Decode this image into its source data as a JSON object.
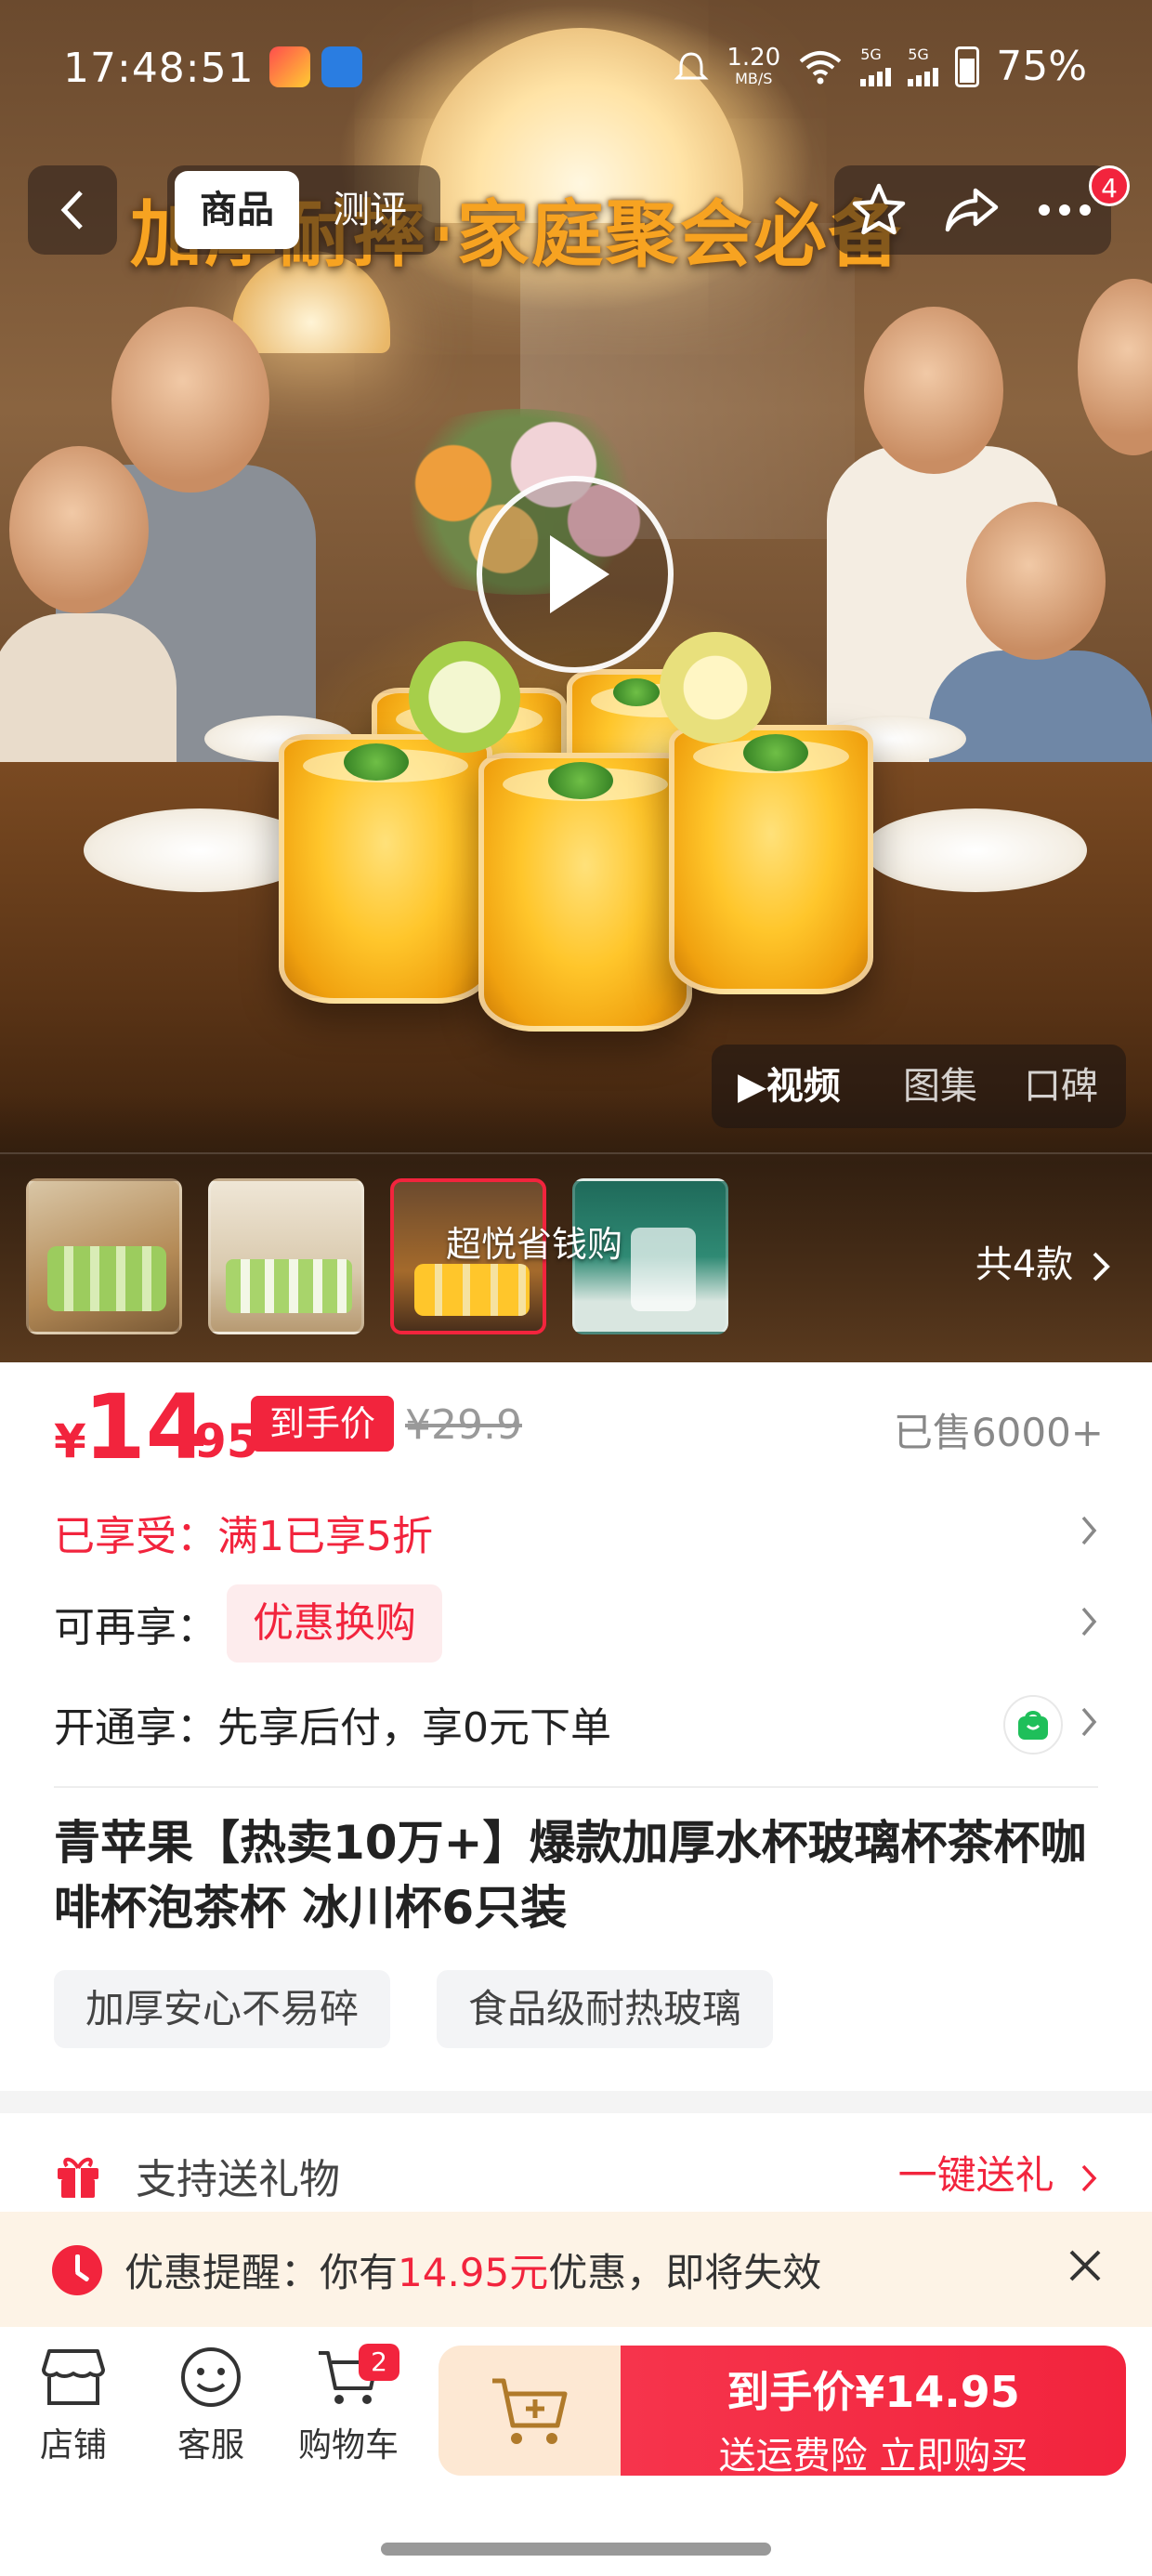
{
  "status_bar": {
    "time": "17:48:51",
    "net_speed_value": "1.20",
    "net_speed_unit": "MB/S",
    "signal1_label": "5G",
    "signal2_label": "5G",
    "battery": "75%"
  },
  "header": {
    "tabs": [
      "商品",
      "测评"
    ],
    "cart_badge_count": "4"
  },
  "hero": {
    "banner_text": "加厚耐摔·家庭聚会必备",
    "media_tabs": [
      "视频",
      "图集",
      "口碑"
    ],
    "thumb_overlay": "超悦省钱购",
    "total_label": "共4款"
  },
  "price": {
    "currency": "¥",
    "integer": "14",
    "decimal": ".95",
    "price_tag": "到手价",
    "original": "¥29.9",
    "sold": "已售6000+"
  },
  "promos": {
    "enjoyed": "已享受：满1已享5折",
    "more_label": "可再享：",
    "more_pill": "优惠换购",
    "open_label": "开通享：先享后付，享0元下单"
  },
  "product": {
    "title": "青苹果【热卖10万+】爆款加厚水杯玻璃杯茶杯咖啡杯泡茶杯 冰川杯6只装",
    "features": [
      "加厚安心不易碎",
      "食品级耐热玻璃"
    ]
  },
  "gift": {
    "label": "支持送礼物",
    "action": "一键送礼"
  },
  "reminder": {
    "prefix": "优惠提醒：你有",
    "amount": "14.95元",
    "suffix": "优惠，即将失效"
  },
  "bottom_nav": {
    "items": [
      "店铺",
      "客服",
      "购物车"
    ],
    "cart_count": "2",
    "buy_line1": "到手价¥14.95",
    "buy_line2": "送运费险 立即购买"
  },
  "colors": {
    "accent": "#f2243d",
    "banner_orange": "#f7a321"
  }
}
